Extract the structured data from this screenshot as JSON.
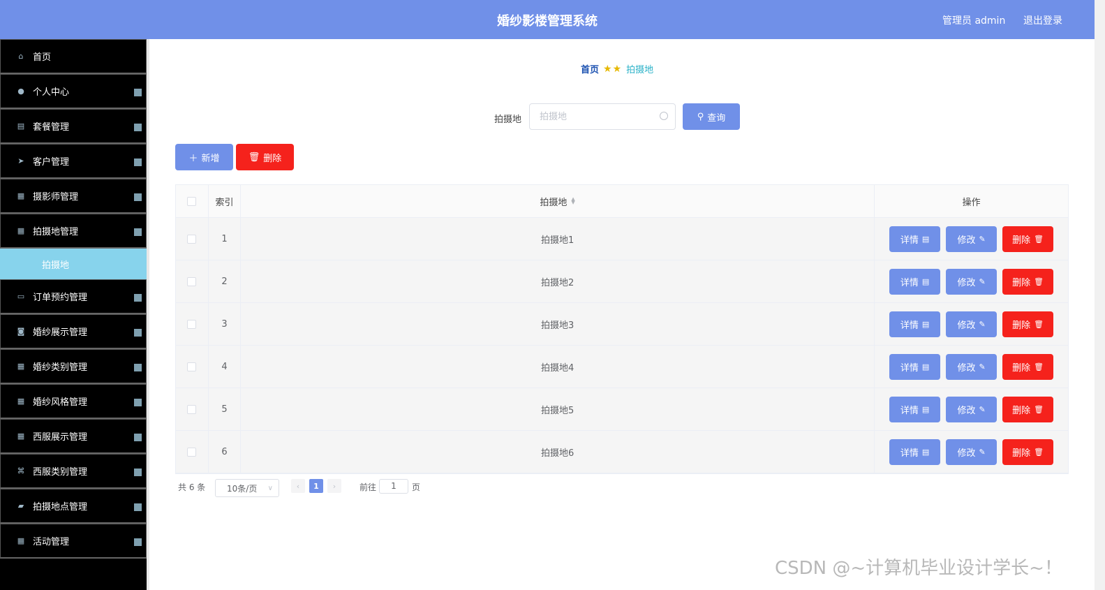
{
  "header": {
    "title": "婚纱影楼管理系统",
    "user": "管理员 admin",
    "logout": "退出登录"
  },
  "sidebar": {
    "items": [
      {
        "label": "首页",
        "icon": "home-icon"
      },
      {
        "label": "个人中心",
        "icon": "user-icon"
      },
      {
        "label": "套餐管理",
        "icon": "chart-icon"
      },
      {
        "label": "客户管理",
        "icon": "send-icon"
      },
      {
        "label": "摄影师管理",
        "icon": "grid-icon"
      },
      {
        "label": "拍摄地管理",
        "icon": "grid-icon"
      },
      {
        "label": "订单预约管理",
        "icon": "monitor-icon"
      },
      {
        "label": "婚纱展示管理",
        "icon": "camera-icon"
      },
      {
        "label": "婚纱类别管理",
        "icon": "grid-icon"
      },
      {
        "label": "婚纱风格管理",
        "icon": "grid-icon"
      },
      {
        "label": "西服展示管理",
        "icon": "grid-icon"
      },
      {
        "label": "西服类别管理",
        "icon": "ticket-icon"
      },
      {
        "label": "拍摄地点管理",
        "icon": "chat-icon"
      },
      {
        "label": "活动管理",
        "icon": "grid-icon"
      }
    ],
    "submenu_label": "拍摄地"
  },
  "breadcrumb": {
    "home": "首页",
    "current": "拍摄地"
  },
  "search": {
    "label": "拍摄地",
    "placeholder": "拍摄地",
    "query_button": "查询"
  },
  "actions": {
    "add": "新增",
    "delete": "删除"
  },
  "table": {
    "columns": {
      "index": "索引",
      "location": "拍摄地",
      "operation": "操作"
    },
    "rows": [
      {
        "index": "1",
        "location": "拍摄地1"
      },
      {
        "index": "2",
        "location": "拍摄地2"
      },
      {
        "index": "3",
        "location": "拍摄地3"
      },
      {
        "index": "4",
        "location": "拍摄地4"
      },
      {
        "index": "5",
        "location": "拍摄地5"
      },
      {
        "index": "6",
        "location": "拍摄地6"
      }
    ],
    "row_buttons": {
      "detail": "详情",
      "edit": "修改",
      "delete": "删除"
    }
  },
  "pagination": {
    "total": "共 6 条",
    "page_size": "10条/页",
    "current_page": "1",
    "goto_prefix": "前往",
    "goto_value": "1",
    "goto_suffix": "页"
  },
  "watermark": "CSDN @~计算机毕业设计学长~！",
  "colors": {
    "header": "#7090e8",
    "primary": "#7090e8",
    "danger": "#f5221c",
    "sidebar": "#000000",
    "submenu_active": "#87d3ec"
  }
}
